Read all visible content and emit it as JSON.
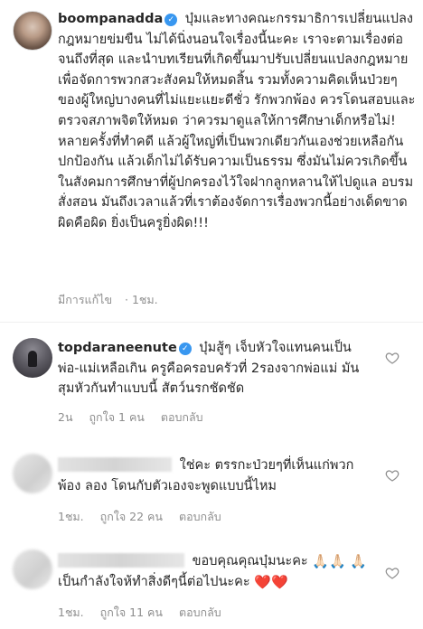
{
  "post": {
    "username": "boompanadda",
    "caption": "บุ๋มและทางคณะกรรมาธิการเปลี่ยนแปลงกฎหมายข่มขืน ไม่ได้นิ่งนอนใจเรื่องนี้นะคะ เราจะตามเรื่องต่อจนถึงที่สุด และนำบทเรียนที่เกิดขึ้นมาปรับเปลี่ยนแปลงกฎหมายเพื่อจัดการพวกสวะสังคมให้หมดสิ้น รวมทั้งความคิดเห็นป่วยๆของผู้ใหญ่บางคนที่ไม่แยะแยะดีชั่ว รักพวกพ้อง ควรโดนสอบและตรวจสภาพจิตให้หมด ว่าควรมาดูแลให้การศึกษาเด็กหรือไม่! หลายครั้งที่ทำคดี แล้วผู้ใหญ่ที่เป็นพวกเดียวกันเองช่วยเหลือกัน ปกป้องกัน แล้วเด็กไม่ได้รับความเป็นธรรม ซึ่งมันไม่ควรเกิดขึ้นในสังคมการศึกษาที่ผู้ปกครองไว้ใจฝากลูกหลานให้ไปดูแล อบรมสั่งสอน มันถึงเวลาแล้วที่เราต้องจัดการเรื่องพวกนี้อย่างเด็ดขาด ผิดคือผิด ยิ่งเป็นครูยิ่งผิด!!!",
    "edited": "มีการแก้ไข",
    "time": "1ชม."
  },
  "comments": [
    {
      "username": "topdaraneenute",
      "text": "บุ๋มสู้ๆ เจ็บหัวใจแทนคนเป็นพ่อ-แม่เหลือเกิน ครูคือครอบครัวที่ 2รองจากพ่อแม่ มันสุมหัวกันทำแบบนี้ สัตว์นรกชัดชัด",
      "time": "2น",
      "likes": "ถูกใจ 1 คน",
      "reply": "ตอบกลับ"
    },
    {
      "username": "",
      "text": "ใช่คะ ตรรกะป่วยๆที่เห็นแก่พวกพ้อง ลอง โดนกับตัวเองจะพูดแบบนี้ไหม",
      "time": "1ชม.",
      "likes": "ถูกใจ 22 คน",
      "reply": "ตอบกลับ"
    },
    {
      "username": "",
      "text_before": "ขอบคุณคุณบุ๋มนะคะ",
      "emoji_pray": "🙏🏻🙏🏻",
      "emoji_pray_single": "🙏🏻",
      "text_after": "เป็นกำลังใจห้ทำสิ่งดีๆนี้ต่อไปนะคะ",
      "emoji_hearts": "❤️❤️",
      "time": "1ชม.",
      "likes": "ถูกใจ 11 คน",
      "reply": "ตอบกลับ"
    }
  ],
  "colors": {
    "verified": "#3897f0",
    "muted": "#8e8e8e",
    "text": "#262626"
  },
  "icons": [
    "verified-badge-icon",
    "heart-outline-icon"
  ]
}
